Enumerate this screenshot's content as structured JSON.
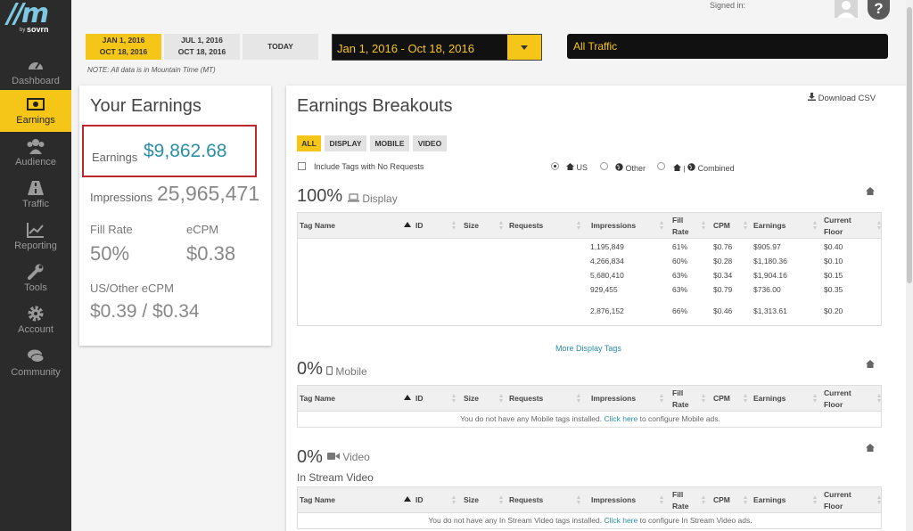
{
  "brand": {
    "logo": "//m",
    "by": "by",
    "sovrn": "sovrn"
  },
  "nav": [
    {
      "label": "Dashboard",
      "icon": "dashboard-icon"
    },
    {
      "label": "Earnings",
      "icon": "money-icon",
      "active": true
    },
    {
      "label": "Audience",
      "icon": "users-icon"
    },
    {
      "label": "Traffic",
      "icon": "road-icon"
    },
    {
      "label": "Reporting",
      "icon": "chart-line-icon"
    },
    {
      "label": "Tools",
      "icon": "wrench-icon"
    },
    {
      "label": "Account",
      "icon": "gear-icon"
    },
    {
      "label": "Community",
      "icon": "comments-icon"
    }
  ],
  "header": {
    "date_buttons": [
      {
        "line1": "JAN 1, 2016",
        "line2": "OCT 18, 2016"
      },
      {
        "line1": "JUL 1, 2016",
        "line2": "OCT 18, 2016"
      },
      {
        "line1": "TODAY"
      }
    ],
    "range": "Jan 1, 2016 - Oct 18, 2016",
    "traffic": "All Traffic",
    "note": "NOTE: All data is in Mountain Time (MT)",
    "signed_in": "Signed in:",
    "help": "?"
  },
  "earnings": {
    "title": "Your Earnings",
    "earnings_label": "Earnings",
    "earnings_value": "$9,862.68",
    "impressions_label": "Impressions",
    "impressions_value": "25,965,471",
    "fill_rate_label": "Fill Rate",
    "fill_rate_value": "50%",
    "ecpm_label": "eCPM",
    "ecpm_value": "$0.38",
    "us_other_label": "US/Other eCPM",
    "us_other_value": "$0.39 / $0.34"
  },
  "breakouts": {
    "title": "Earnings Breakouts",
    "download": "Download CSV",
    "tabs": [
      "ALL",
      "DISPLAY",
      "MOBILE",
      "VIDEO"
    ],
    "include_label": "Include Tags with No Requests",
    "radios": [
      "US",
      "Other",
      "Combined"
    ],
    "columns": [
      "Tag Name",
      "ID",
      "Size",
      "Requests",
      "Impressions",
      "Fill Rate",
      "CPM",
      "Earnings",
      "Current Floor"
    ],
    "display": {
      "pct": "100%",
      "label": "Display",
      "rows": [
        [
          "1,195,849",
          "61%",
          "$0.76",
          "$905.97",
          "$0.40"
        ],
        [
          "4,266,834",
          "60%",
          "$0.28",
          "$1,180.36",
          "$0.10"
        ],
        [
          "5,680,410",
          "63%",
          "$0.34",
          "$1,904.16",
          "$0.15"
        ],
        [
          "929,455",
          "63%",
          "$0.79",
          "$736.00",
          "$0.35"
        ],
        [
          "2,876,152",
          "66%",
          "$0.46",
          "$1,313.61",
          "$0.20"
        ]
      ],
      "more": "More Display Tags"
    },
    "mobile": {
      "pct": "0%",
      "label": "Mobile",
      "empty": "You do not have any Mobile tags installed.",
      "link": "Click here",
      "suffix": "to configure Mobile ads."
    },
    "video": {
      "pct": "0%",
      "label": "Video",
      "sub": "In Stream Video",
      "empty": "You do not have any In Stream Video tags installed.",
      "link": "Click here",
      "suffix": "to configure In Stream Video ads."
    }
  },
  "colors": {
    "accent": "#f5c518",
    "sidebar": "#2b2b2b",
    "link": "#2a8fa8",
    "highlight": "#c0272d"
  }
}
